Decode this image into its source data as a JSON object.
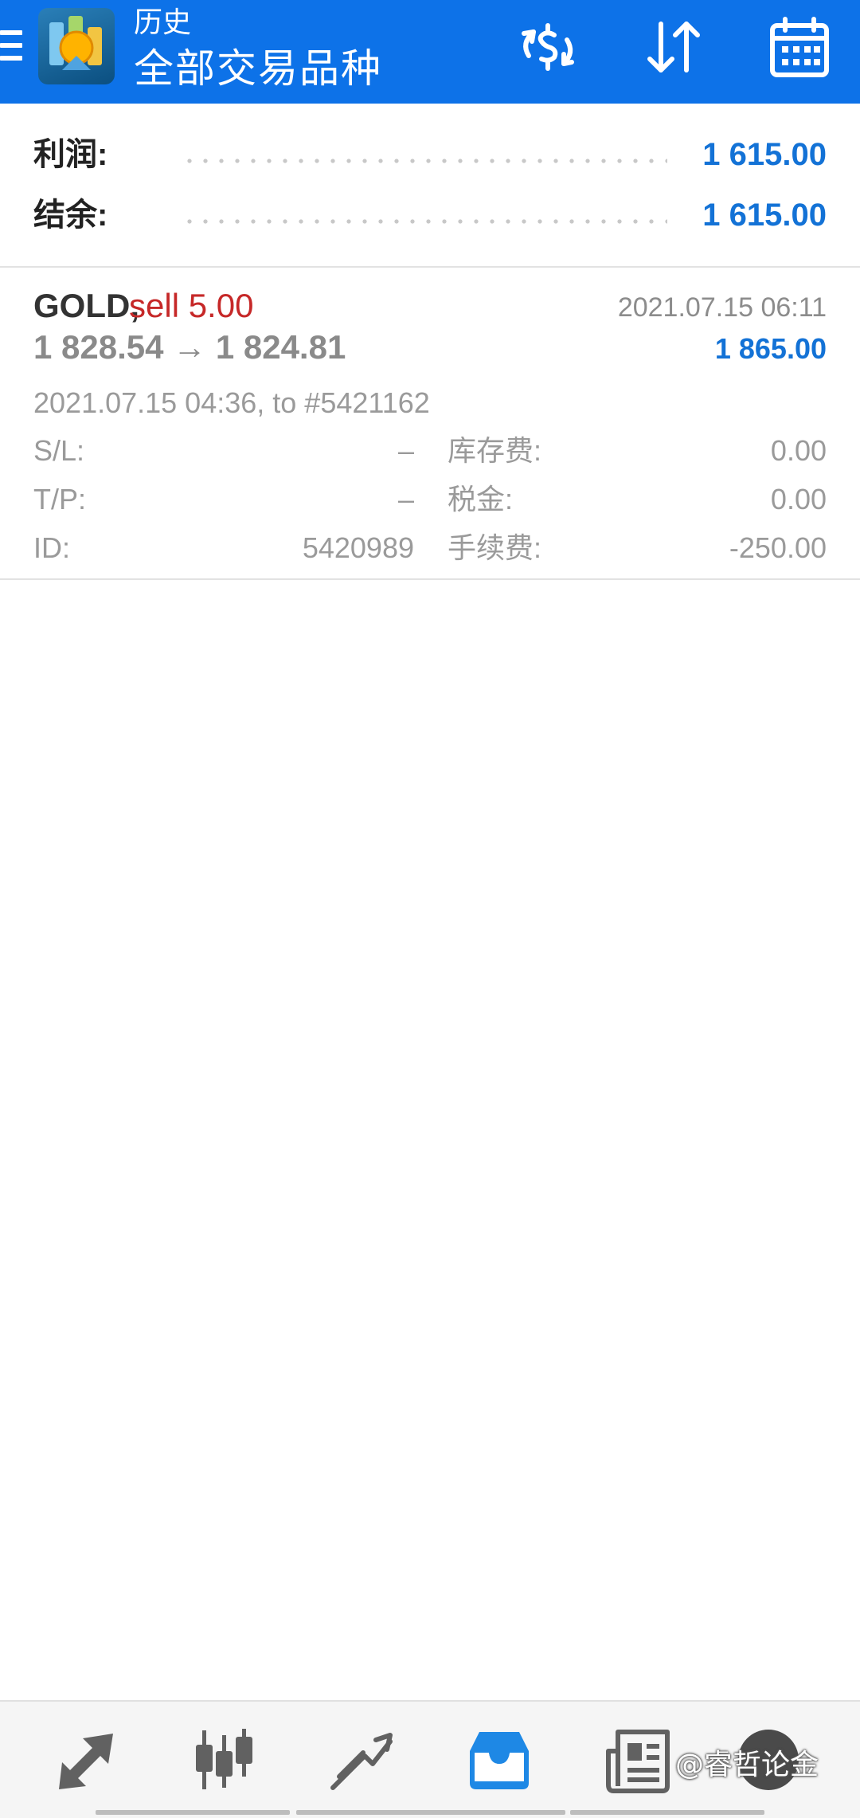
{
  "appbar": {
    "subtitle": "历史",
    "title": "全部交易品种",
    "colors": {
      "background": "#0d72e8",
      "foreground": "#ffffff"
    },
    "actions": [
      {
        "name": "currency-exchange-icon"
      },
      {
        "name": "sort-icon"
      },
      {
        "name": "calendar-icon"
      }
    ]
  },
  "summary": {
    "profit_label": "利润:",
    "profit_value": "1 615.00",
    "balance_label": "结余:",
    "balance_value": "1 615.00",
    "value_color": "#1372d6"
  },
  "deal": {
    "symbol": "GOLD,",
    "action": "sell 5.00",
    "close_time": "2021.07.15 06:11",
    "prices": "1 828.54 → 1 824.81",
    "profit": "1 865.00",
    "open_info": "2021.07.15 04:36, to #5421162",
    "sl_label": "S/L:",
    "sl_value": "–",
    "swap_label": "库存费:",
    "swap_value": "0.00",
    "tp_label": "T/P:",
    "tp_value": "–",
    "taxes_label": "税金:",
    "taxes_value": "0.00",
    "id_label": "ID:",
    "id_value": "5420989",
    "commission_label": "手续费:",
    "commission_value": "-250.00",
    "action_color": "#c62828"
  },
  "bottom_nav": {
    "items": [
      {
        "name": "quotes-icon"
      },
      {
        "name": "chart-icon"
      },
      {
        "name": "trade-icon"
      },
      {
        "name": "history-icon",
        "active": true
      },
      {
        "name": "news-icon"
      },
      {
        "name": "messages-icon"
      }
    ],
    "active_color": "#1e88e5",
    "icon_color": "#616161"
  },
  "watermark": "@睿哲论金"
}
